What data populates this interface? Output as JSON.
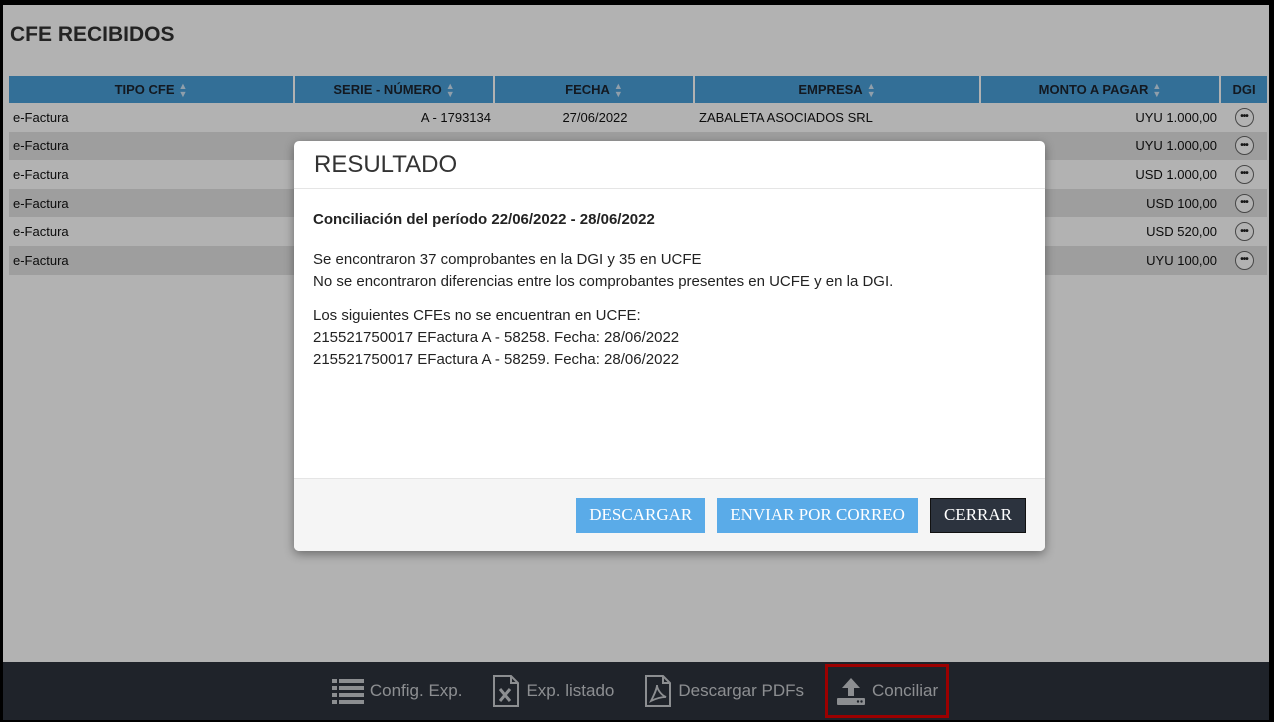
{
  "page": {
    "title": "CFE RECIBIDOS"
  },
  "table": {
    "headers": [
      "TIPO CFE",
      "SERIE - NÚMERO",
      "FECHA",
      "EMPRESA",
      "MONTO A PAGAR",
      "DGI"
    ],
    "rows": [
      {
        "tipo": "e-Factura",
        "serie": "A - 1793134",
        "fecha": "27/06/2022",
        "empresa": "ZABALETA ASOCIADOS SRL",
        "monto": "UYU 1.000,00"
      },
      {
        "tipo": "e-Factura",
        "serie": "",
        "fecha": "",
        "empresa": "",
        "monto": "UYU 1.000,00"
      },
      {
        "tipo": "e-Factura",
        "serie": "",
        "fecha": "",
        "empresa": "",
        "monto": "USD 1.000,00"
      },
      {
        "tipo": "e-Factura",
        "serie": "",
        "fecha": "",
        "empresa": "",
        "monto": "USD 100,00"
      },
      {
        "tipo": "e-Factura",
        "serie": "",
        "fecha": "",
        "empresa": "",
        "monto": "USD 520,00"
      },
      {
        "tipo": "e-Factura",
        "serie": "",
        "fecha": "",
        "empresa": "",
        "monto": "UYU 100,00"
      }
    ]
  },
  "modal": {
    "title": "RESULTADO",
    "heading": "Conciliación del período 22/06/2022 - 28/06/2022",
    "line1": "Se encontraron 37 comprobantes en la DGI y 35 en UCFE",
    "line2": "No se encontraron diferencias entre los comprobantes presentes en UCFE y en la DGI.",
    "line3": "Los siguientes CFEs no se encuentran en UCFE:",
    "line4": "215521750017 EFactura A - 58258. Fecha: 28/06/2022",
    "line5": "215521750017 EFactura A - 58259. Fecha: 28/06/2022",
    "btn_descargar": "DESCARGAR",
    "btn_enviar": "ENVIAR POR CORREO",
    "btn_cerrar": "CERRAR"
  },
  "bottombar": {
    "config_exp": "Config. Exp.",
    "exp_listado": "Exp. listado",
    "descargar_pdfs": "Descargar PDFs",
    "conciliar": "Conciliar"
  },
  "colors": {
    "header_blue": "#4a9fd8",
    "button_blue": "#5aabe8",
    "bar_dark": "#2d333d",
    "highlight": "#e00000"
  }
}
